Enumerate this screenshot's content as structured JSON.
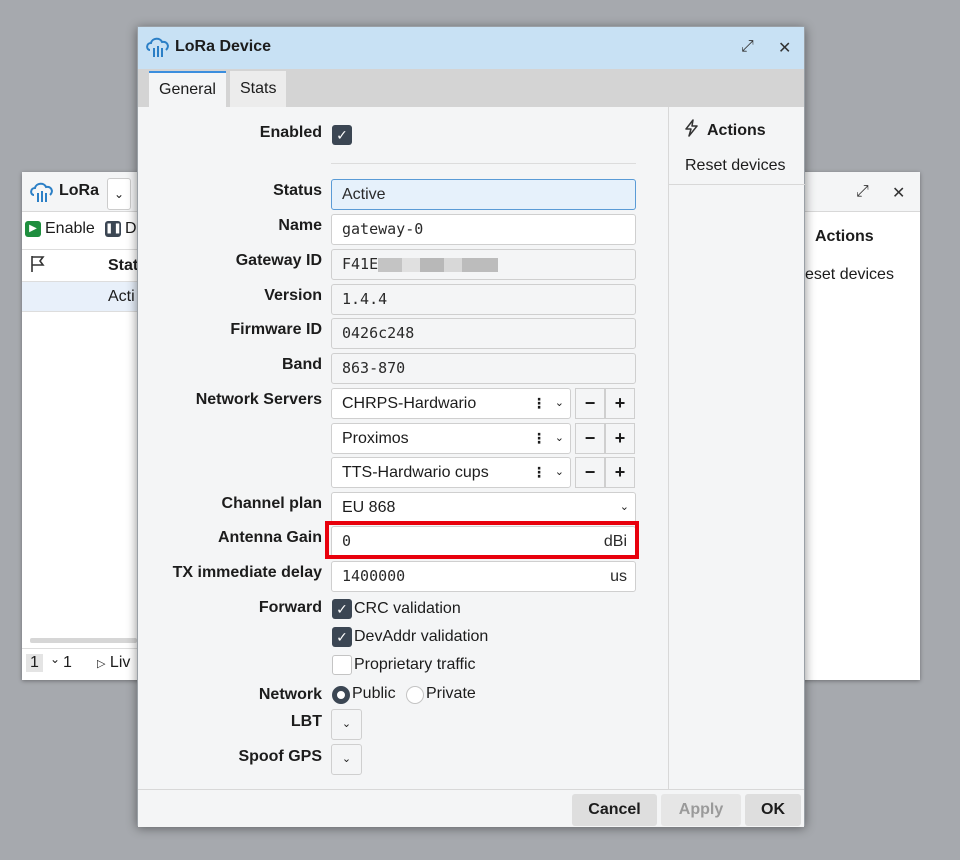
{
  "background_window": {
    "title": "LoRa",
    "toolbar": {
      "enable_label": "Enable",
      "disable_label_partial": "D"
    },
    "table": {
      "status_header_partial": "Stat",
      "row_status_partial": "Acti"
    },
    "footer": {
      "page": "1",
      "page_total": "1",
      "live_label_partial": "Liv"
    },
    "actions": {
      "title": "Actions",
      "reset_label_partial": "eset devices"
    }
  },
  "dialog": {
    "title": "LoRa Device",
    "tabs": [
      {
        "label": "General"
      },
      {
        "label": "Stats"
      }
    ],
    "fields": {
      "enabled": {
        "label": "Enabled",
        "checked": true
      },
      "status": {
        "label": "Status",
        "value": "Active"
      },
      "name": {
        "label": "Name",
        "value": "gateway-0"
      },
      "gateway_id": {
        "label": "Gateway ID",
        "value": "F41E"
      },
      "version": {
        "label": "Version",
        "value": "1.4.4"
      },
      "firmware_id": {
        "label": "Firmware ID",
        "value": "0426c248"
      },
      "band": {
        "label": "Band",
        "value": "863-870"
      },
      "network_servers": {
        "label": "Network Servers",
        "items": [
          "CHRPS-Hardwario",
          "Proximos",
          "TTS-Hardwario cups"
        ]
      },
      "channel_plan": {
        "label": "Channel plan",
        "value": "EU 868"
      },
      "antenna_gain": {
        "label": "Antenna Gain",
        "value": "0",
        "unit": "dBi"
      },
      "tx_delay": {
        "label": "TX immediate delay",
        "value": "1400000",
        "unit": "us"
      },
      "forward": {
        "label": "Forward",
        "options": [
          {
            "label": "CRC validation",
            "checked": true
          },
          {
            "label": "DevAddr validation",
            "checked": true
          },
          {
            "label": "Proprietary traffic",
            "checked": false
          }
        ]
      },
      "network": {
        "label": "Network",
        "public_label": "Public",
        "private_label": "Private",
        "selected": "Public"
      },
      "lbt": {
        "label": "LBT"
      },
      "spoof_gps": {
        "label": "Spoof GPS"
      }
    },
    "actions": {
      "title": "Actions",
      "reset_label": "Reset devices"
    },
    "buttons": {
      "cancel": "Cancel",
      "apply": "Apply",
      "ok": "OK"
    }
  }
}
